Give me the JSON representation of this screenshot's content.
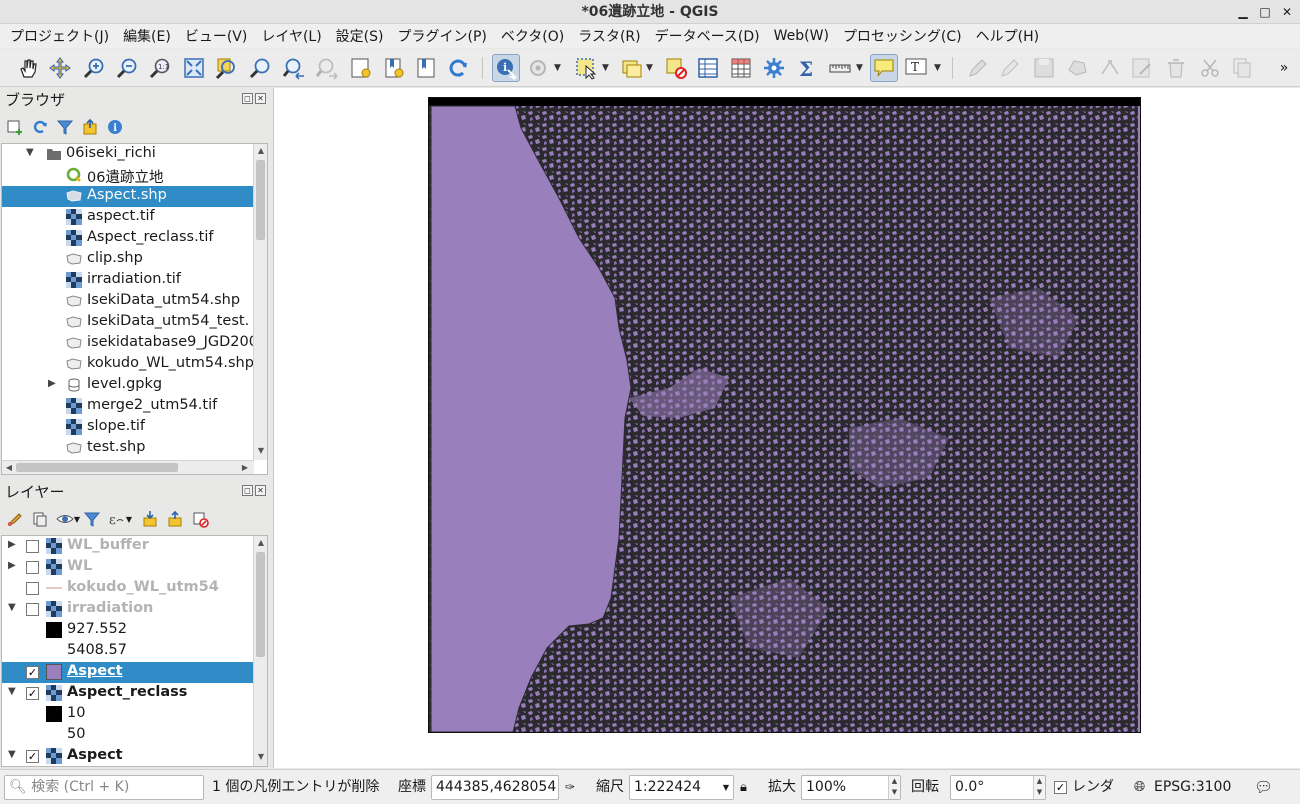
{
  "window": {
    "title": "*06遺跡立地 - QGIS",
    "minimize": "▁",
    "maximize": "□",
    "close": "✕"
  },
  "menu": [
    "プロジェクト(J)",
    "編集(E)",
    "ビュー(V)",
    "レイヤ(L)",
    "設定(S)",
    "プラグイン(P)",
    "ベクタ(O)",
    "ラスタ(R)",
    "データベース(D)",
    "Web(W)",
    "プロセッシング(C)",
    "ヘルプ(H)"
  ],
  "toolbar": {
    "overflow": "»"
  },
  "browser": {
    "title": "ブラウザ",
    "items": [
      {
        "label": "06iseki_richi",
        "icon": "folder-icon"
      },
      {
        "label": "06遺跡立地",
        "icon": "qgis-project-icon"
      },
      {
        "label": "Aspect.shp",
        "icon": "polygon-layer-icon"
      },
      {
        "label": "aspect.tif",
        "icon": "raster-layer-icon"
      },
      {
        "label": "Aspect_reclass.tif",
        "icon": "raster-layer-icon"
      },
      {
        "label": "clip.shp",
        "icon": "polygon-layer-icon"
      },
      {
        "label": "irradiation.tif",
        "icon": "raster-layer-icon"
      },
      {
        "label": "IsekiData_utm54.shp",
        "icon": "polygon-layer-icon"
      },
      {
        "label": "IsekiData_utm54_test.",
        "icon": "polygon-layer-icon"
      },
      {
        "label": "isekidatabase9_JGD200",
        "icon": "polygon-layer-icon"
      },
      {
        "label": "kokudo_WL_utm54.shp",
        "icon": "polygon-layer-icon"
      },
      {
        "label": "level.gpkg",
        "icon": "database-icon"
      },
      {
        "label": "merge2_utm54.tif",
        "icon": "raster-layer-icon"
      },
      {
        "label": "slope.tif",
        "icon": "raster-layer-icon"
      },
      {
        "label": "test.shp",
        "icon": "polygon-layer-icon"
      }
    ]
  },
  "layers": {
    "title": "レイヤー",
    "items": [
      {
        "label": "WL_buffer",
        "checked": false
      },
      {
        "label": "WL",
        "checked": false
      },
      {
        "label": "kokudo_WL_utm54",
        "checked": false
      },
      {
        "label": "irradiation",
        "checked": false
      },
      {
        "label": "927.552"
      },
      {
        "label": "5408.57"
      },
      {
        "label": "Aspect",
        "checked": true
      },
      {
        "label": "Aspect_reclass",
        "checked": true
      },
      {
        "label": "10"
      },
      {
        "label": "50"
      },
      {
        "label": "Aspect",
        "checked": true
      }
    ],
    "check_mark": "✓"
  },
  "status": {
    "search_placeholder": "検索 (Ctrl + K)",
    "message": "1 個の凡例エントリが削除",
    "coord_label": "座標",
    "coord_value": "444385,4628054",
    "scale_label": "縮尺",
    "scale_value": "1:222424",
    "magnifier_label": "拡大",
    "magnifier_value": "100%",
    "rotation_label": "回転",
    "rotation_value": "0.0°",
    "render_label": "レンダ",
    "crs": "EPSG:3100"
  },
  "colors": {
    "selection": "#308cc6",
    "polygon_fill": "#9a7fbd",
    "polygon_outline": "#2b2a2e"
  }
}
